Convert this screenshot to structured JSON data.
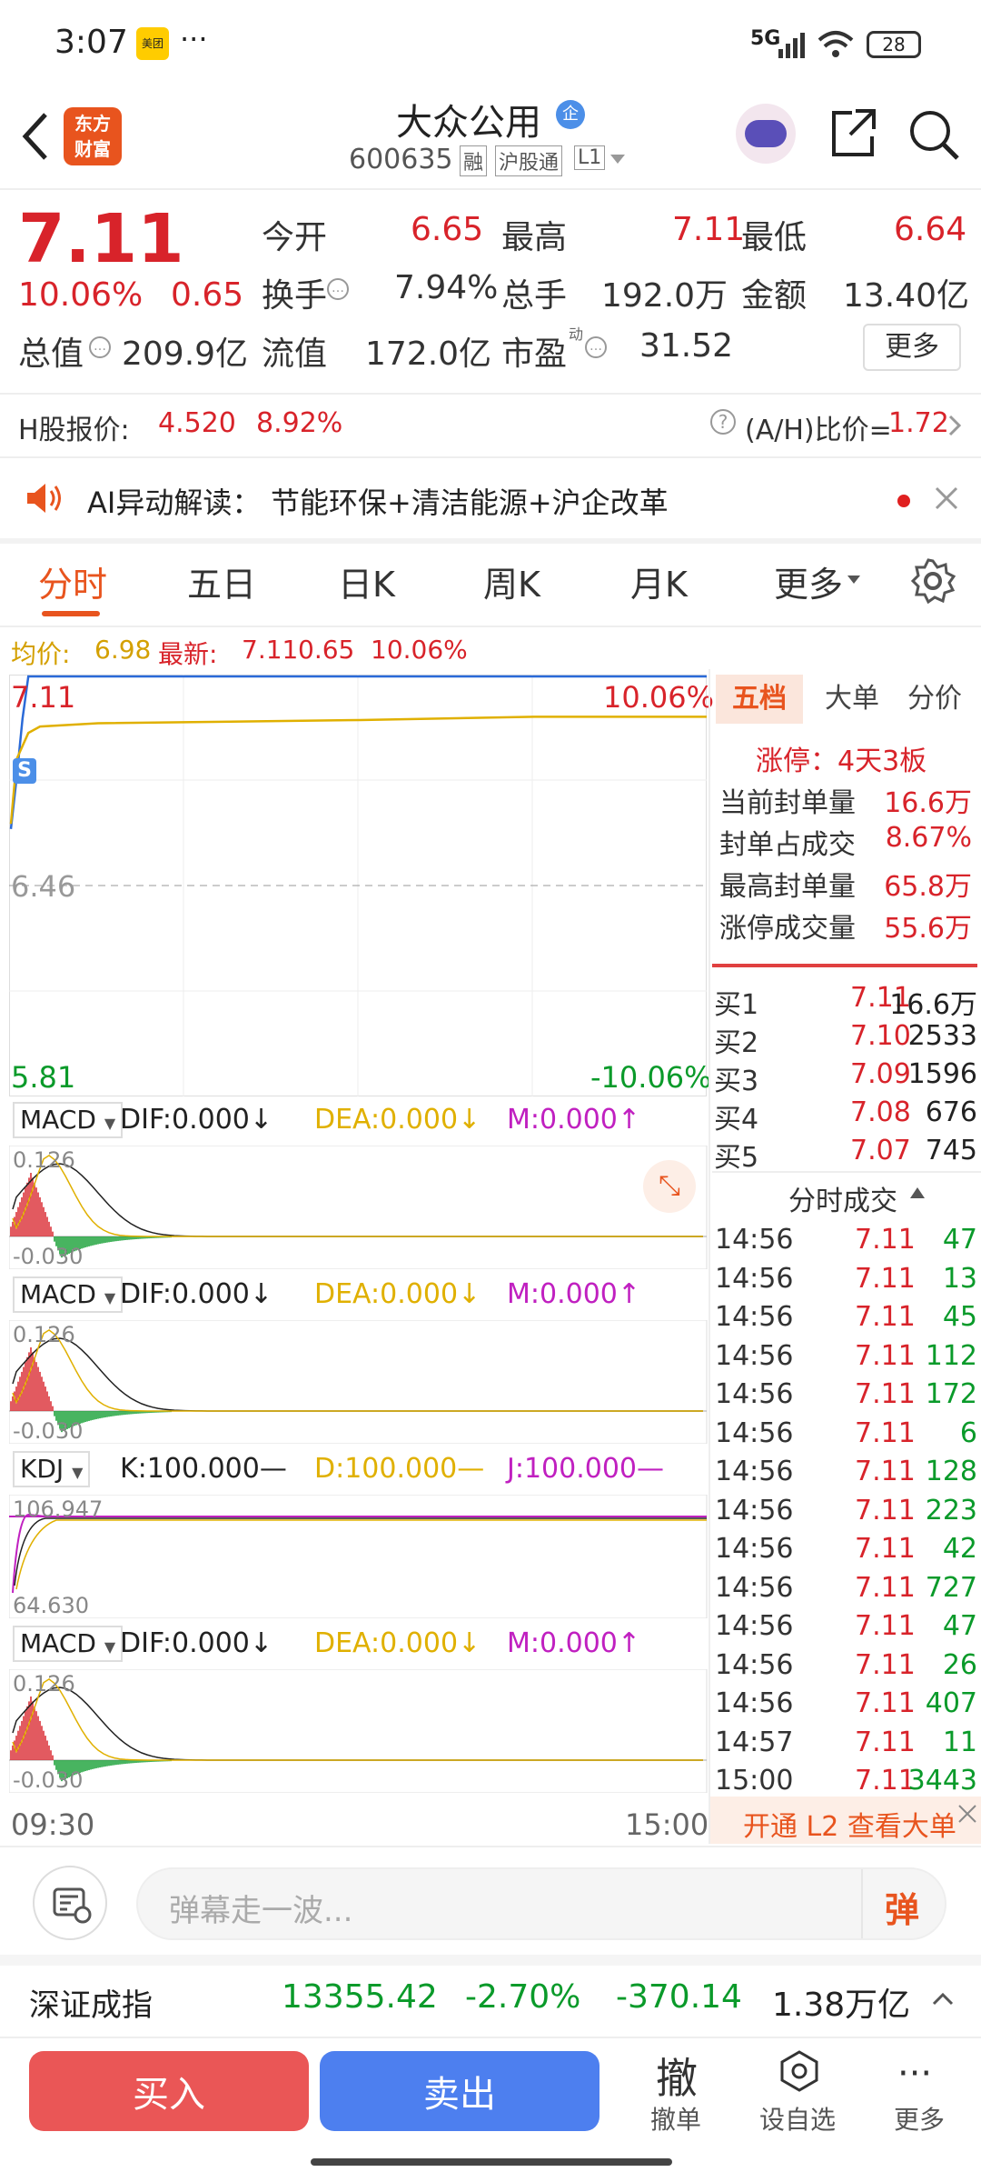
{
  "status": {
    "time": "3:07",
    "badge": "美团",
    "net": "5G",
    "battery": "28"
  },
  "header": {
    "name": "大众公用",
    "tag": "企",
    "code": "600635",
    "badges": [
      "融",
      "沪股通",
      "L1"
    ],
    "logo_line1": "东方",
    "logo_line2": "财富"
  },
  "quote": {
    "price": "7.11",
    "pct": "10.06%",
    "chg": "0.65",
    "open_l": "今开",
    "open": "6.65",
    "high_l": "最高",
    "high": "7.11",
    "low_l": "最低",
    "low": "6.64",
    "turn_l": "换手",
    "turn": "7.94%",
    "vol_l": "总手",
    "vol": "192.0万",
    "amt_l": "金额",
    "amt": "13.40亿",
    "cap_l": "总值",
    "cap": "209.9亿",
    "float_l": "流值",
    "float": "172.0亿",
    "pe_l": "市盈",
    "pe_sup": "动",
    "pe": "31.52",
    "more": "更多"
  },
  "hshare": {
    "label": "H股报价:",
    "price": "4.520",
    "pct": "8.92%",
    "ah": "(A/H)比价=",
    "ah_val": "1.72"
  },
  "ai": {
    "prefix": "AI异动解读：",
    "text": "节能环保+清洁能源+沪企改革"
  },
  "tabs": [
    "分时",
    "五日",
    "日K",
    "周K",
    "月K",
    "更多"
  ],
  "avg": {
    "avg_l": "均价:",
    "avg": "6.98",
    "last_l": "最新:",
    "last": "7.11",
    "chg": "0.65",
    "pct": "10.06%"
  },
  "chart": {
    "top_price": "7.11",
    "top_pct": "10.06%",
    "mid": "6.46",
    "bot_price": "5.81",
    "bot_pct": "-10.06%",
    "start": "09:30",
    "end": "15:00",
    "s_mark": "S"
  },
  "chart_data": {
    "type": "line",
    "title": "",
    "xlim": [
      "09:30",
      "15:00"
    ],
    "ylim": [
      5.81,
      7.11
    ],
    "series": [
      {
        "name": "",
        "x": [
          "09:30",
          "09:32",
          "09:34",
          "09:36",
          "09:40",
          "10:00",
          "11:30",
          "13:00",
          "14:00",
          "15:00"
        ],
        "values": [
          6.64,
          6.8,
          6.98,
          7.11,
          7.11,
          7.11,
          7.11,
          7.11,
          7.11,
          7.11
        ]
      },
      {
        "name": "均价",
        "x": [
          "09:30",
          "09:32",
          "09:36",
          "09:40",
          "10:00",
          "11:30",
          "13:00",
          "14:00",
          "15:00"
        ],
        "values": [
          6.65,
          6.85,
          6.93,
          6.95,
          6.96,
          6.97,
          6.97,
          6.98,
          6.98
        ]
      }
    ]
  },
  "panel_tabs": [
    "五档",
    "大单",
    "分价"
  ],
  "limit": {
    "title": "涨停：4天3板",
    "rows": [
      {
        "l": "当前封单量",
        "v": "16.6万"
      },
      {
        "l": "封单占成交",
        "v": "8.67%"
      },
      {
        "l": "最高封单量",
        "v": "65.8万"
      },
      {
        "l": "涨停成交量",
        "v": "55.6万"
      }
    ]
  },
  "book": [
    {
      "l": "买1",
      "p": "7.11",
      "v": "16.6万"
    },
    {
      "l": "买2",
      "p": "7.10",
      "v": "2533"
    },
    {
      "l": "买3",
      "p": "7.09",
      "v": "1596"
    },
    {
      "l": "买4",
      "p": "7.08",
      "v": "676"
    },
    {
      "l": "买5",
      "p": "7.07",
      "v": "745"
    }
  ],
  "trades_title": "分时成交",
  "trades": [
    {
      "t": "14:56",
      "p": "7.11",
      "v": "47"
    },
    {
      "t": "14:56",
      "p": "7.11",
      "v": "13"
    },
    {
      "t": "14:56",
      "p": "7.11",
      "v": "45"
    },
    {
      "t": "14:56",
      "p": "7.11",
      "v": "112"
    },
    {
      "t": "14:56",
      "p": "7.11",
      "v": "172"
    },
    {
      "t": "14:56",
      "p": "7.11",
      "v": "6"
    },
    {
      "t": "14:56",
      "p": "7.11",
      "v": "128"
    },
    {
      "t": "14:56",
      "p": "7.11",
      "v": "223"
    },
    {
      "t": "14:56",
      "p": "7.11",
      "v": "42"
    },
    {
      "t": "14:56",
      "p": "7.11",
      "v": "727"
    },
    {
      "t": "14:56",
      "p": "7.11",
      "v": "47"
    },
    {
      "t": "14:56",
      "p": "7.11",
      "v": "26"
    },
    {
      "t": "14:56",
      "p": "7.11",
      "v": "407"
    },
    {
      "t": "14:57",
      "p": "7.11",
      "v": "11"
    },
    {
      "t": "15:00",
      "p": "7.11",
      "v": "3443"
    }
  ],
  "l2": "开通 L2 查看大单",
  "ind": {
    "macd": "MACD",
    "dif": "DIF:0.000↓",
    "dea": "DEA:0.000↓",
    "m": "M:0.000↑",
    "macd_top": "0.126",
    "macd_bot": "-0.030",
    "kdj": "KDJ",
    "k": "K:100.000—",
    "d": "D:100.000—",
    "j": "J:100.000—",
    "kdj_top": "106.947",
    "kdj_bot": "64.630"
  },
  "danmu": "弹幕走一波...",
  "danmu_btn": "弹",
  "index": {
    "name": "深证成指",
    "val": "13355.42",
    "pct": "-2.70%",
    "chg": "-370.14",
    "amt": "1.38万亿"
  },
  "bottom": {
    "buy": "买入",
    "sell": "卖出",
    "cancel_big": "撤",
    "cancel": "撤单",
    "fav": "设自选",
    "more": "更多"
  },
  "colors": {
    "up": "#d8232a",
    "down": "#0a9a2a",
    "accent": "#e8541e"
  }
}
